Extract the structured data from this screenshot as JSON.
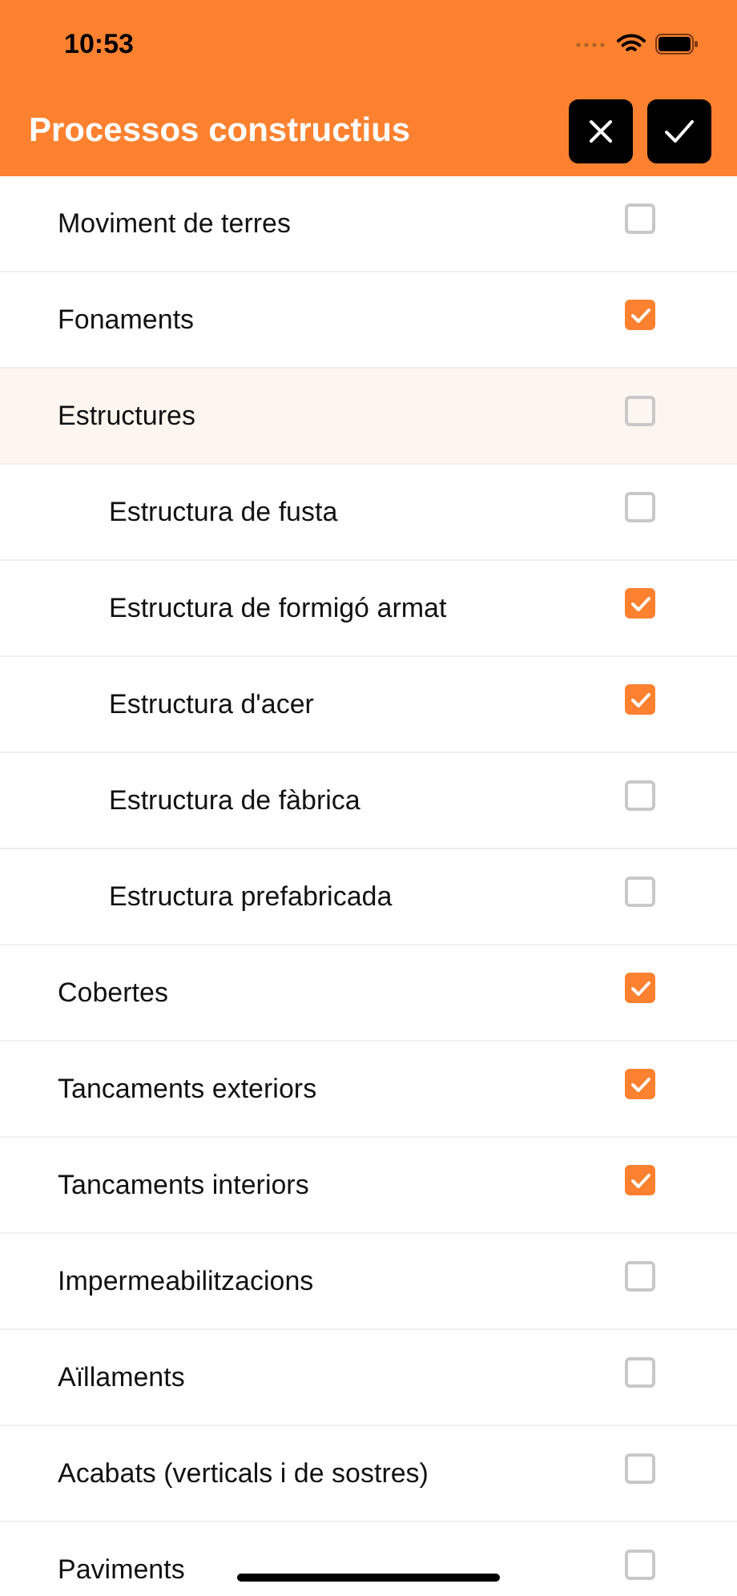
{
  "status_bar": {
    "time": "10:53"
  },
  "header": {
    "title": "Processos constructius"
  },
  "items": [
    {
      "label": "Moviment de terres",
      "checked": false,
      "selected": false
    },
    {
      "label": "Fonaments",
      "checked": true,
      "selected": false
    },
    {
      "label": "Estructures",
      "checked": false,
      "selected": true,
      "children": [
        {
          "label": "Estructura de fusta",
          "checked": false,
          "selected": false
        },
        {
          "label": "Estructura de formigó armat",
          "checked": true,
          "selected": false
        },
        {
          "label": "Estructura d'acer",
          "checked": true,
          "selected": false
        },
        {
          "label": "Estructura de fàbrica",
          "checked": false,
          "selected": false
        },
        {
          "label": "Estructura prefabricada",
          "checked": false,
          "selected": false
        }
      ]
    },
    {
      "label": "Cobertes",
      "checked": true,
      "selected": false
    },
    {
      "label": "Tancaments exteriors",
      "checked": true,
      "selected": false
    },
    {
      "label": "Tancaments interiors",
      "checked": true,
      "selected": false
    },
    {
      "label": "Impermeabilitzacions",
      "checked": false,
      "selected": false
    },
    {
      "label": "Aïllaments",
      "checked": false,
      "selected": false
    },
    {
      "label": "Acabats (verticals i de sostres)",
      "checked": false,
      "selected": false
    },
    {
      "label": "Paviments",
      "checked": false,
      "selected": false
    }
  ]
}
